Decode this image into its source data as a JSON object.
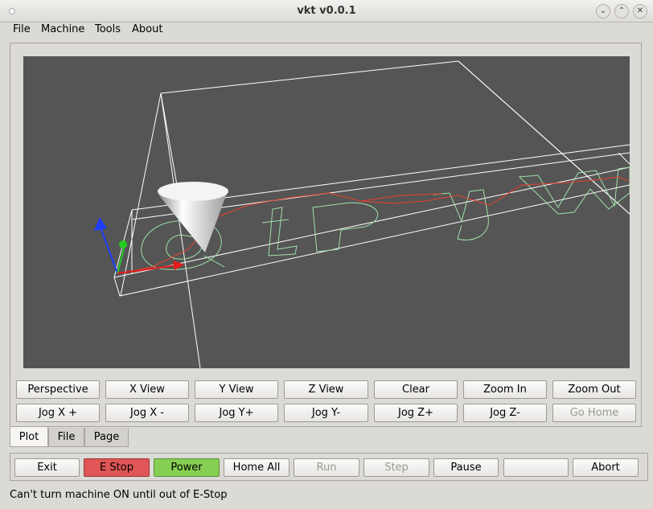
{
  "window": {
    "title": "vkt v0.0.1",
    "buttons": [
      "⌄",
      "⌃",
      "✕"
    ]
  },
  "menu": [
    "File",
    "Machine",
    "Tools",
    "About"
  ],
  "view_buttons": [
    "Perspective",
    "X View",
    "Y View",
    "Z View",
    "Clear",
    "Zoom In",
    "Zoom Out"
  ],
  "jog_buttons": [
    "Jog X +",
    "Jog X -",
    "Jog Y+",
    "Jog Y-",
    "Jog Z+",
    "Jog Z-",
    "Go Home"
  ],
  "tabs": [
    "Plot",
    "File",
    "Page"
  ],
  "controls": [
    "Exit",
    "E Stop",
    "Power",
    "Home All",
    "Run",
    "Step",
    "Pause",
    "",
    "Abort"
  ],
  "status": "Can't turn machine ON until out of E-Stop",
  "colors": {
    "estop": "#e05555",
    "power": "#86cf53",
    "viewport": "#555555"
  }
}
